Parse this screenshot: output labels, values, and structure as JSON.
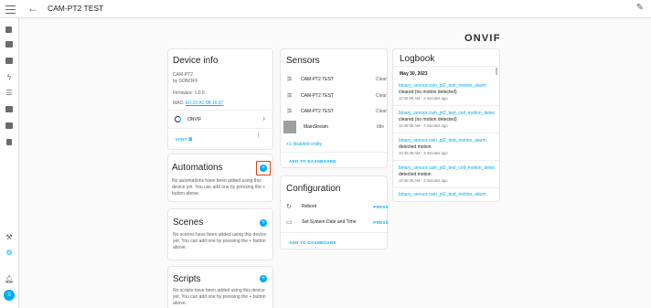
{
  "header": {
    "title": "CAM-PT2 TEST"
  },
  "sidebar": {
    "avatar_letter": "S"
  },
  "logo": "ONVIF",
  "device_info": {
    "title": "Device info",
    "model": "CAM-PT2",
    "manufacturer": "by SONOFF",
    "firmware": "Firmware: 1.0.5",
    "mac_label": "MAC:",
    "mac_value": "E0:22:A1:98:16:97",
    "integration": "ONVIF",
    "visit_label": "VISIT"
  },
  "automations": {
    "title": "Automations",
    "text": "No automations have been added using this device yet. You can add one by pressing the + button above."
  },
  "scenes": {
    "title": "Scenes",
    "text": "No scenes have been added using this device yet. You can add one by pressing the + button above."
  },
  "scripts": {
    "title": "Scripts",
    "text": "No scripts have been added using this device yet. You can add one by pressing the + button above."
  },
  "sensors": {
    "title": "Sensors",
    "items": [
      {
        "name": "CAM-PT2 TEST",
        "state": "Clear"
      },
      {
        "name": "CAM-PT2 TEST",
        "state": "Clear"
      },
      {
        "name": "CAM-PT2 TEST",
        "state": "Clear"
      },
      {
        "name": "MainStream",
        "state": "Idle"
      }
    ],
    "disabled_entity": "+1 disabled entity",
    "add_to_dashboard": "ADD TO DASHBOARD"
  },
  "configuration": {
    "title": "Configuration",
    "items": [
      {
        "name": "Reboot",
        "action": "PRESS"
      },
      {
        "name": "Set System Date and Time",
        "action": "PRESS"
      }
    ],
    "add_to_dashboard": "ADD TO DASHBOARD"
  },
  "logbook": {
    "title": "Logbook",
    "date": "May 30, 2023",
    "entries": [
      {
        "entity": "binary_sensor.cam_pt2_test_motion_alarm",
        "message": "cleared (no motion detected)",
        "time": "10:46:08 AM - 3 minutes ago"
      },
      {
        "entity": "binary_sensor.cam_pt2_test_cell_motion_detec",
        "message": "cleared (no motion detected)",
        "time": "10:46:08 AM - 3 minutes ago"
      },
      {
        "entity": "binary_sensor.cam_pt2_test_motion_alarm",
        "message": "detected motion",
        "time": "10:45:48 AM - 3 minutes ago"
      },
      {
        "entity": "binary_sensor.cam_pt2_test_cell_motion_detec",
        "message": "detected motion",
        "time": "10:45:48 AM - 3 minutes ago"
      },
      {
        "entity": "binary_sensor.cam_pt2_test_motion_alarm",
        "message": "",
        "time": ""
      }
    ]
  },
  "colors": {
    "accent": "#03a9f4",
    "highlight": "#d84315"
  }
}
